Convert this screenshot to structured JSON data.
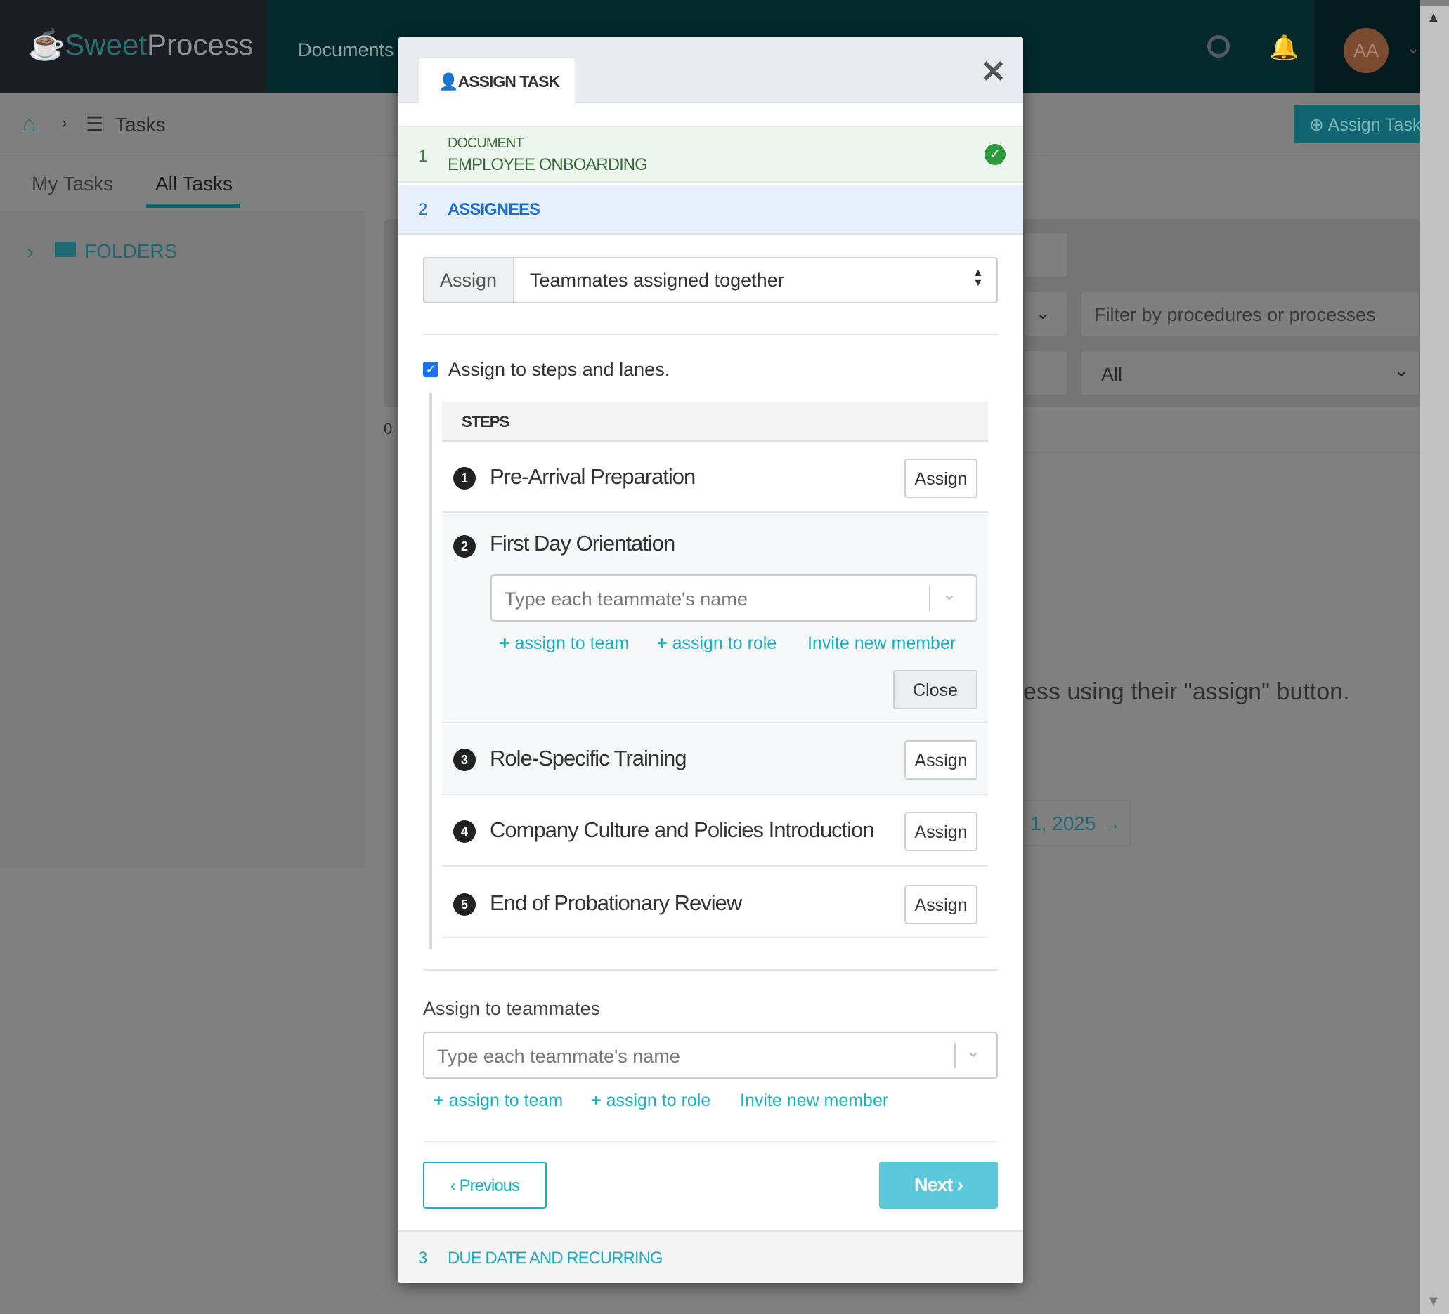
{
  "app": {
    "logo_sweet": "Sweet",
    "logo_process": "Process",
    "nav_documents": "Documents",
    "avatar_initials": "AA"
  },
  "background": {
    "breadcrumb_current": "Tasks",
    "tabs": [
      {
        "label": "My Tasks"
      },
      {
        "label": "All Tasks",
        "active": true
      }
    ],
    "folders": "FOLDERS",
    "assign_task_button": "Assign Task",
    "filter_placeholder": "Filter by procedures or processes",
    "filter_all": "All",
    "count_zero": "0",
    "hint_text": "ess using their \"assign\" button.",
    "date_nav": "1, 2025"
  },
  "modal": {
    "tab_label": "ASSIGN TASK",
    "steps": [
      {
        "num": "1",
        "label": "DOCUMENT",
        "value": "EMPLOYEE ONBOARDING",
        "complete": true
      },
      {
        "num": "2",
        "label": "ASSIGNEES",
        "active": true
      },
      {
        "num": "3",
        "label": "DUE DATE AND RECURRING"
      }
    ],
    "assign_addon": "Assign",
    "assign_mode": "Teammates assigned together",
    "checkbox_label": "Assign to steps and lanes.",
    "checkbox_checked": true,
    "steps_header": "STEPS",
    "task_steps": [
      {
        "num": "1",
        "title": "Pre-Arrival Preparation",
        "button": "Assign"
      },
      {
        "num": "2",
        "title": "First Day Orientation",
        "expanded": true
      },
      {
        "num": "3",
        "title": "Role-Specific Training",
        "button": "Assign"
      },
      {
        "num": "4",
        "title": "Company Culture and Policies Introduction",
        "button": "Assign"
      },
      {
        "num": "5",
        "title": "End of Probationary Review",
        "button": "Assign"
      }
    ],
    "teammate_placeholder": "Type each teammate's name",
    "assign_to_team": "assign to team",
    "assign_to_role": "assign to role",
    "invite_new_member": "Invite new member",
    "close_button": "Close",
    "assign_to_teammates_label": "Assign to teammates",
    "previous_button": "Previous",
    "next_button": "Next"
  },
  "colors": {
    "accent": "#1ab0c4",
    "active_step": "#1a6fd0",
    "success": "#2e9a3e",
    "next_button": "#5bc8dc"
  }
}
